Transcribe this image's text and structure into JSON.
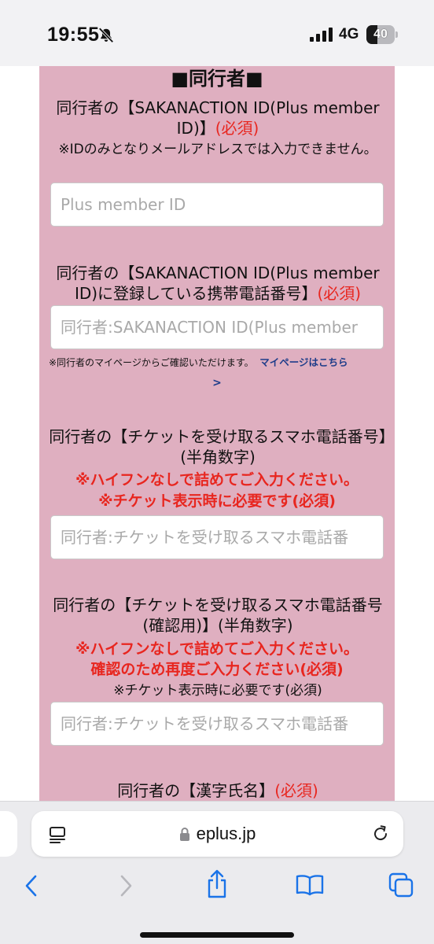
{
  "status": {
    "time": "19:55",
    "network": "4G",
    "battery": "40",
    "battery_level_percent": 40
  },
  "form": {
    "section_title": "■同行者■",
    "fields": [
      {
        "label": "同行者の【SAKANACTION ID(Plus member ID)】",
        "required": "(必須)",
        "note": "※IDのみとなりメールアドレスでは入力できません。",
        "placeholder": "Plus member ID"
      },
      {
        "label": "同行者の【SAKANACTION ID(Plus member ID)に登録している携帯電話番号】",
        "required": "(必須)",
        "placeholder": "同行者:SAKANACTION ID(Plus member",
        "small_note": "※同行者のマイページからご確認いただけます。",
        "link_text": "マイページはこちら",
        "link_arrow": ">"
      },
      {
        "label": "同行者の【チケットを受け取るスマホ電話番号】(半角数字)",
        "warn_1": "※ハイフンなしで詰めてご入力ください。",
        "warn_2": "※チケット表示時に必要です(必須)",
        "placeholder": "同行者:チケットを受け取るスマホ電話番"
      },
      {
        "label": "同行者の【チケットを受け取るスマホ電話番号(確認用)】(半角数字)",
        "warn_1": "※ハイフンなしで詰めてご入力ください。",
        "warn_2": "確認のため再度ご入力ください(必須)",
        "note": "※チケット表示時に必要です(必須)",
        "placeholder": "同行者:チケットを受け取るスマホ電話番"
      },
      {
        "label": "同行者の【漢字氏名】",
        "required": "(必須)"
      }
    ]
  },
  "browser": {
    "url": "eplus.jp"
  },
  "icons": {
    "silent": "bell-slash-icon",
    "signal": "cellular-signal-icon",
    "reader": "reader-mode-icon",
    "lock": "lock-icon",
    "reload": "reload-icon",
    "back": "chevron-left-icon",
    "forward": "chevron-right-icon",
    "share": "share-icon",
    "bookmarks": "book-icon",
    "tabs": "tabs-icon"
  },
  "colors": {
    "panel": "#dfafc0",
    "required_red": "#e8261f",
    "link_blue": "#1f3d8a",
    "ios_blue": "#1a73e8"
  }
}
